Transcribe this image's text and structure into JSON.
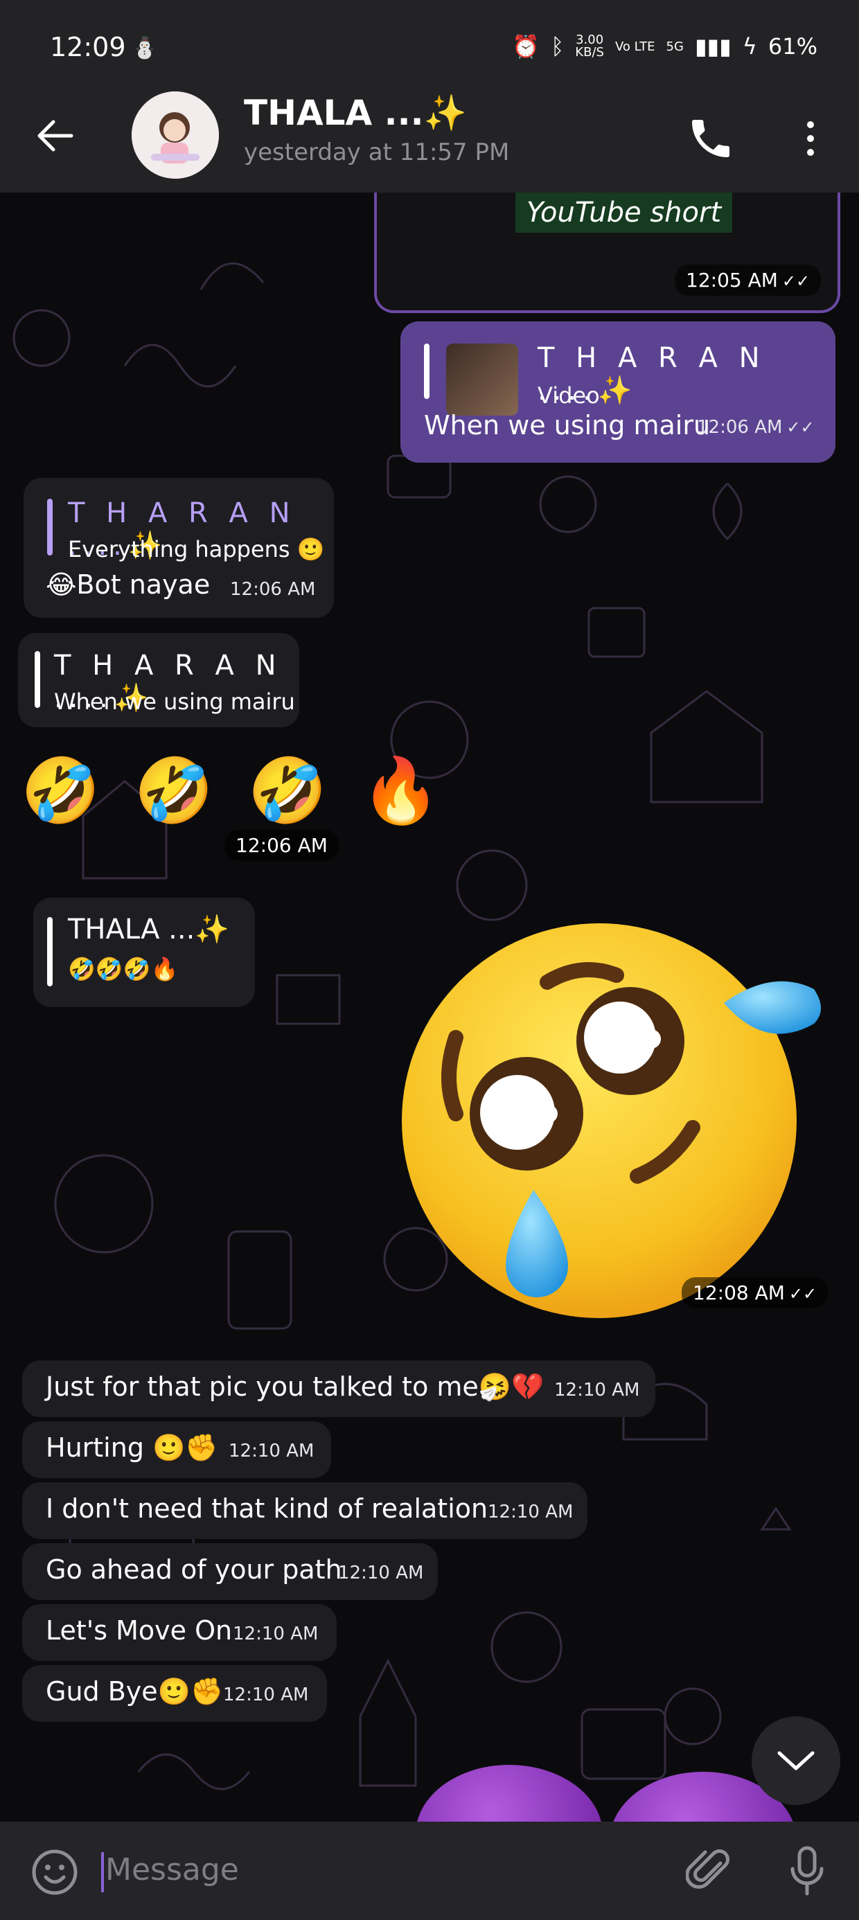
{
  "status_bar": {
    "time": "12:09",
    "network_speed_top": "3.00",
    "network_speed_bottom": "KB/S",
    "volte": "Vo LTE",
    "network": "5G",
    "battery": "61%"
  },
  "header": {
    "title": "THALA ...✨",
    "subtitle": "yesterday at 11:57 PM"
  },
  "messages": {
    "video_card": {
      "label": "YouTube short",
      "time": "12:05 AM"
    },
    "out_reply": {
      "reply_name": "T H A R A N ....✨",
      "reply_type": "Video",
      "text": "When we using mairu",
      "time": "12:06 AM"
    },
    "in_reply_1": {
      "reply_name": "T H A R A N ....✨",
      "reply_text": "Everything happens 🙂",
      "text": "😂Bot nayae",
      "time": "12:06 AM"
    },
    "in_reply_2": {
      "reply_name": "T H A R A N ....✨",
      "reply_text": "When we using mairu"
    },
    "emoji_row": {
      "emojis": "🤣 🤣 🤣 🔥",
      "time": "12:06 AM"
    },
    "in_reply_3": {
      "reply_name": "THALA ...✨",
      "reply_text": "🤣🤣🤣🔥"
    },
    "sticker": {
      "time": "12:08 AM"
    },
    "texts": [
      {
        "text": "Just for that pic you talked to me🤧💔",
        "time": "12:10 AM"
      },
      {
        "text": "Hurting 🙂✊",
        "time": "12:10 AM"
      },
      {
        "text": "I don't need that kind of realation",
        "time": "12:10 AM"
      },
      {
        "text": "Go ahead of your path",
        "time": "12:10 AM"
      },
      {
        "text": "Let's Move On",
        "time": "12:10 AM"
      },
      {
        "text": "Gud Bye🙂✊",
        "time": "12:10 AM"
      }
    ]
  },
  "input": {
    "placeholder": "Message"
  },
  "colors": {
    "outgoing_bubble": "#5b4391",
    "incoming_bubble": "#1e1e22",
    "header_bg": "#232325",
    "accent": "#8a62d6"
  }
}
